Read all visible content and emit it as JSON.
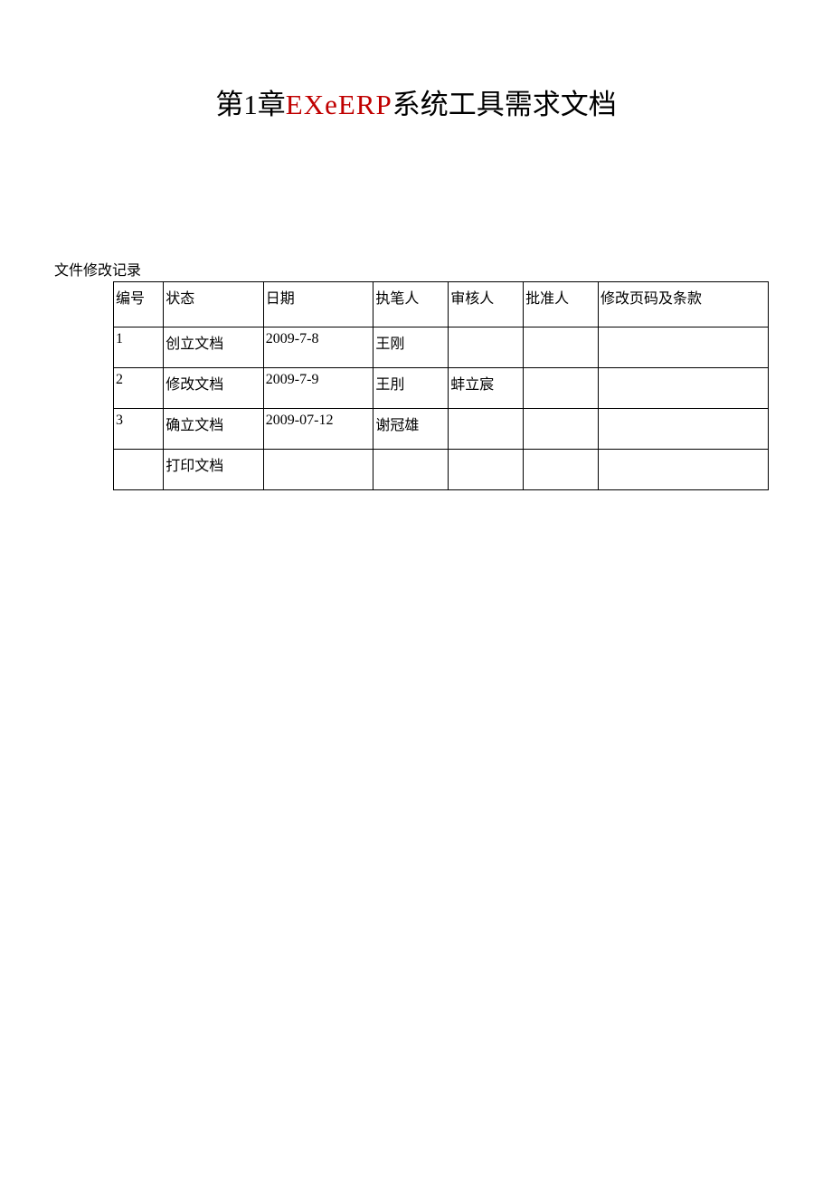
{
  "title": {
    "prefix": "第1章",
    "red": "EXeERP",
    "suffix": "系统工具需求文档"
  },
  "section_label": "文件修改记录",
  "table": {
    "headers": {
      "id": "编号",
      "status": "状态",
      "date": "日期",
      "author": "执笔人",
      "reviewer": "审核人",
      "approver": "批准人",
      "pages": "修改页码及条款"
    },
    "rows": [
      {
        "id": "1",
        "status": "创立文档",
        "date": "2009-7-8",
        "author": "王刚",
        "reviewer": "",
        "approver": "",
        "pages": ""
      },
      {
        "id": "2",
        "status": "修改文档",
        "date": "2009-7-9",
        "author": "王刖",
        "reviewer": "蚌立宸",
        "approver": "",
        "pages": ""
      },
      {
        "id": "3",
        "status": "确立文档",
        "date": "2009-07-12",
        "author": "谢冠雄",
        "reviewer": "",
        "approver": "",
        "pages": ""
      },
      {
        "id": "",
        "status": "打印文档",
        "date": "",
        "author": "",
        "reviewer": "",
        "approver": "",
        "pages": ""
      }
    ]
  }
}
